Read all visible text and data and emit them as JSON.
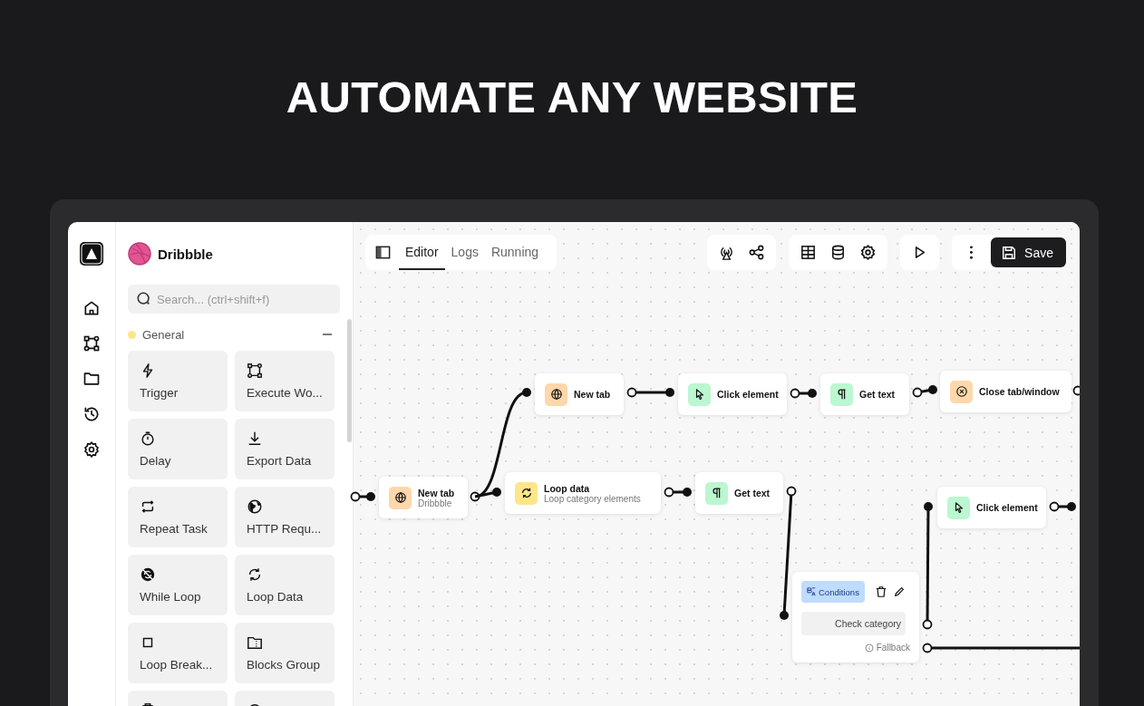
{
  "headline": "AUTOMATE ANY WEBSITE",
  "workflow": {
    "name": "Dribbble"
  },
  "search": {
    "placeholder": "Search... (ctrl+shift+f)"
  },
  "category": {
    "label": "General",
    "color": "#fde68a",
    "expanded": true
  },
  "blocks": [
    {
      "kind": "trigger",
      "label": "Trigger"
    },
    {
      "kind": "execute",
      "label": "Execute Wo..."
    },
    {
      "kind": "delay",
      "label": "Delay"
    },
    {
      "kind": "export",
      "label": "Export Data"
    },
    {
      "kind": "repeat",
      "label": "Repeat Task"
    },
    {
      "kind": "http",
      "label": "HTTP Requ..."
    },
    {
      "kind": "while",
      "label": "While Loop"
    },
    {
      "kind": "loop",
      "label": "Loop Data"
    },
    {
      "kind": "break",
      "label": "Loop Break..."
    },
    {
      "kind": "group",
      "label": "Blocks Group"
    },
    {
      "kind": "clipboard"
    },
    {
      "kind": "note"
    }
  ],
  "tabs": [
    {
      "label": "Editor",
      "selected": true
    },
    {
      "label": "Logs",
      "selected": false
    },
    {
      "label": "Running",
      "selected": false
    }
  ],
  "save_button": "Save",
  "nodes": [
    {
      "kind": "new-tab",
      "title": "New tab",
      "color": "#fed7aa"
    },
    {
      "kind": "click",
      "title": "Click element",
      "color": "#bbf7d0"
    },
    {
      "kind": "get-text",
      "title": "Get text",
      "color": "#bbf7d0"
    },
    {
      "kind": "close-tab",
      "title": "Close tab/window",
      "color": "#fed7aa"
    },
    {
      "kind": "new-tab",
      "title": "New tab",
      "subtitle": "Dribbble",
      "color": "#fed7aa"
    },
    {
      "kind": "loop",
      "title": "Loop data",
      "subtitle": "Loop category elements",
      "color": "#fde68a"
    },
    {
      "kind": "get-text",
      "title": "Get text",
      "color": "#bbf7d0"
    },
    {
      "kind": "click",
      "title": "Click element",
      "color": "#bbf7d0"
    }
  ],
  "condition_node": {
    "badge": "Conditions",
    "condition": "Check category",
    "fallback": "Fallback"
  }
}
